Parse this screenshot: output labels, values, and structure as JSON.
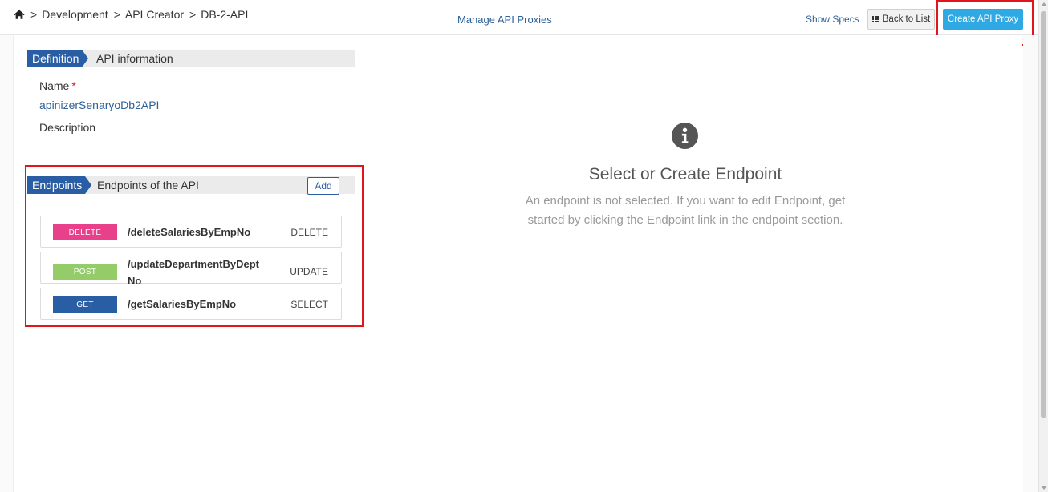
{
  "header": {
    "breadcrumb": [
      "Development",
      "API Creator",
      "DB-2-API"
    ],
    "breadcrumb_separator": ">",
    "page_title": "Manage API Proxies",
    "show_specs_label": "Show Specs",
    "back_label": "Back to List",
    "create_label": "Create API Proxy"
  },
  "definition": {
    "tag": "Definition",
    "title": "API information",
    "name_label": "Name",
    "required_mark": "*",
    "name_value": "apinizerSenaryoDb2API",
    "description_label": "Description"
  },
  "endpoints": {
    "tag": "Endpoints",
    "title": "Endpoints of the API",
    "add_label": "Add",
    "items": [
      {
        "method": "DELETE",
        "path": "/deleteSalariesByEmpNo",
        "operation": "DELETE",
        "color": "#e8408a"
      },
      {
        "method": "POST",
        "path": "/updateDepartmentByDeptNo",
        "operation": "UPDATE",
        "color": "#94cc6a"
      },
      {
        "method": "GET",
        "path": "/getSalariesByEmpNo",
        "operation": "SELECT",
        "color": "#2a5ea4"
      }
    ]
  },
  "empty_state": {
    "icon": "info-circle-icon",
    "title": "Select or Create Endpoint",
    "description": "An endpoint is not selected. If you want to edit Endpoint, get started by clicking the Endpoint link in the endpoint section."
  },
  "colors": {
    "primary": "#2a5ea4",
    "accent": "#2ea9e3",
    "highlight": "#e0161c",
    "link": "#2d5f9a"
  }
}
